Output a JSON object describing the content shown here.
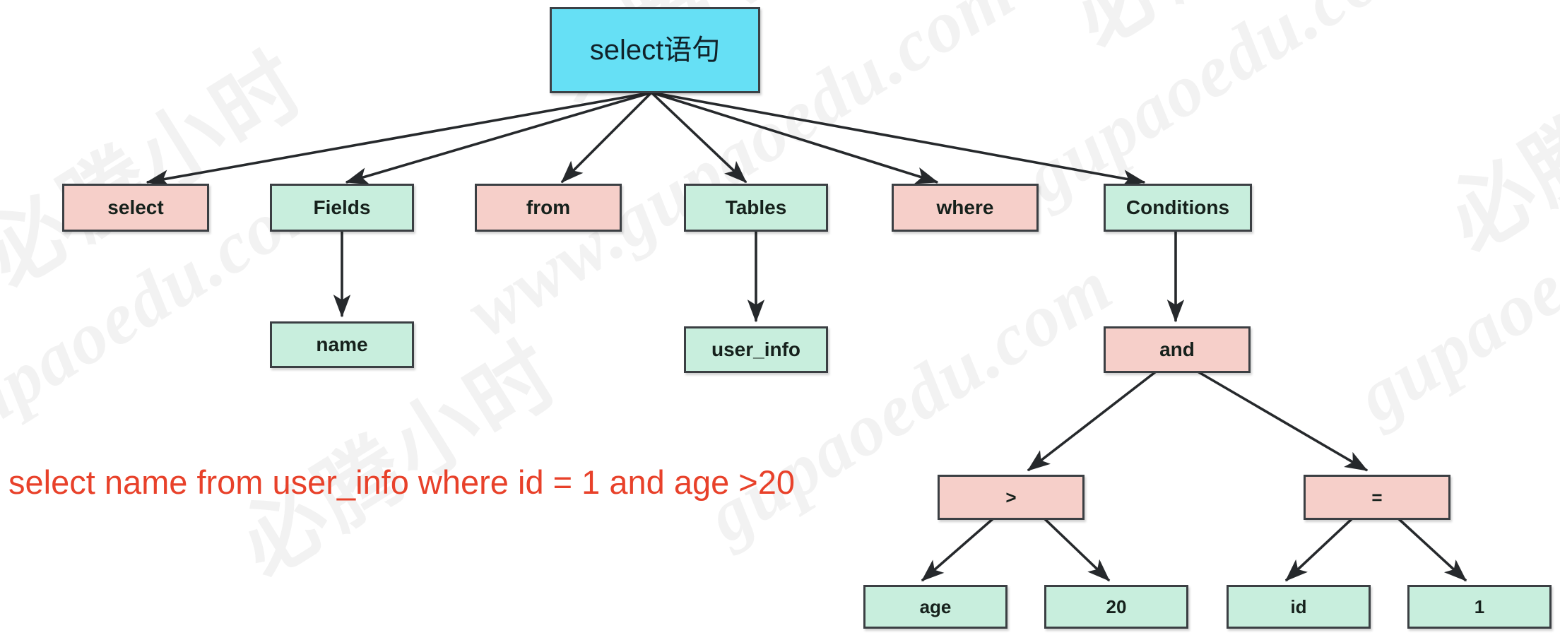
{
  "diagram": {
    "title": "SQL select statement parse tree",
    "colors": {
      "root_fill": "#66e0f5",
      "keyword_fill": "#f6cfc9",
      "value_fill": "#c8eedd",
      "border": "#3b3f43",
      "sql_text": "#e8412a",
      "background": "#ffffff",
      "watermark": "#f2f2f2"
    },
    "root": {
      "label": "select语句"
    },
    "level2": [
      {
        "label": "select",
        "kind": "keyword"
      },
      {
        "label": "Fields",
        "kind": "value"
      },
      {
        "label": "from",
        "kind": "keyword"
      },
      {
        "label": "Tables",
        "kind": "value"
      },
      {
        "label": "where",
        "kind": "keyword"
      },
      {
        "label": "Conditions",
        "kind": "value"
      }
    ],
    "level3": [
      {
        "label": "name",
        "kind": "value",
        "parent": "Fields"
      },
      {
        "label": "user_info",
        "kind": "value",
        "parent": "Tables"
      },
      {
        "label": "and",
        "kind": "keyword",
        "parent": "Conditions"
      }
    ],
    "level4": [
      {
        "label": ">",
        "kind": "keyword",
        "parent": "and"
      },
      {
        "label": "=",
        "kind": "keyword",
        "parent": "and"
      }
    ],
    "level5": [
      {
        "label": "age",
        "kind": "value",
        "parent": ">"
      },
      {
        "label": "20",
        "kind": "value",
        "parent": ">"
      },
      {
        "label": "id",
        "kind": "value",
        "parent": "="
      },
      {
        "label": "1",
        "kind": "value",
        "parent": "="
      }
    ],
    "sql": "select name from user_info where id = 1 and age >20",
    "watermarks": {
      "cn": "必腾小时",
      "en": "gupaoedu.com",
      "url": "www.gupaoedu.com"
    }
  }
}
